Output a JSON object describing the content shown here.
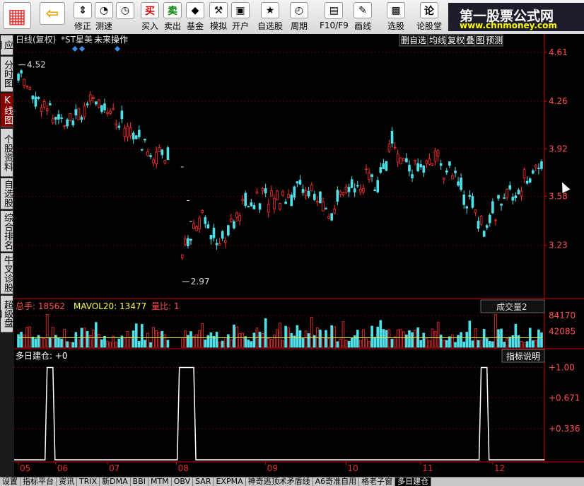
{
  "toolbar": {
    "buttons": [
      {
        "label": "",
        "name": "logo-button",
        "icon": "logo-icon",
        "x": 4
      },
      {
        "label": "",
        "name": "back-button",
        "icon": "back-arrow-icon",
        "x": 56
      },
      {
        "label": "修正",
        "name": "adjust-button",
        "icon": "arrows-icon",
        "x": 104
      },
      {
        "label": "测速",
        "name": "speed-test-button",
        "icon": "speed-icon",
        "x": 134
      },
      {
        "label": "",
        "name": "clock-button",
        "icon": "clock-icon",
        "x": 164
      },
      {
        "label": "买入",
        "name": "buy-button",
        "icon": "buy-icon",
        "x": 199
      },
      {
        "label": "卖出",
        "name": "sell-button",
        "icon": "sell-icon",
        "x": 231
      },
      {
        "label": "基金",
        "name": "fund-button",
        "icon": "fund-icon",
        "x": 263
      },
      {
        "label": "模拟",
        "name": "simulate-button",
        "icon": "hammer-icon",
        "x": 296
      },
      {
        "label": "开户",
        "name": "open-account-button",
        "icon": "lock-icon",
        "x": 327
      },
      {
        "label": "自选股",
        "name": "watchlist-button",
        "icon": "star-icon",
        "x": 364
      },
      {
        "label": "周期",
        "name": "period-button",
        "icon": "period-icon",
        "x": 410
      },
      {
        "label": "F10/F9",
        "name": "f10-button",
        "icon": "f10-icon",
        "x": 452
      },
      {
        "label": "画线",
        "name": "draw-line-button",
        "icon": "pen-icon",
        "x": 500
      },
      {
        "label": "选股",
        "name": "select-stock-button",
        "icon": "select-icon",
        "x": 547
      },
      {
        "label": "论股堂",
        "name": "forum-button",
        "icon": "forum-icon",
        "x": 589
      }
    ],
    "buy_icon": "买",
    "sell_icon": "卖",
    "forum_icon": "论"
  },
  "brand": {
    "title": "第一股票公式网",
    "url": "www.chnmoney.com"
  },
  "left_tabs": [
    {
      "label": "应用",
      "active": false
    },
    {
      "label": "分时图",
      "active": false
    },
    {
      "label": "K线图",
      "active": true
    },
    {
      "label": "个股资料",
      "active": false
    },
    {
      "label": "自选股",
      "active": false
    },
    {
      "label": "综合排名",
      "active": false
    },
    {
      "label": "牛叉诊股",
      "active": false
    },
    {
      "label": "超级盘口",
      "active": false
    }
  ],
  "chart_header": {
    "period": "日线(复权)",
    "stock": "*ST星美",
    "future_op": "未来操作",
    "buttons": [
      "删自选",
      "均线",
      "复权",
      "叠",
      "图",
      "预测"
    ]
  },
  "colors": {
    "up": "#ff3030",
    "down": "#4fe0e8",
    "grid": "#5a0000",
    "axis": "#d00000",
    "white": "#ffffff",
    "yellow": "#ffff40",
    "accent": "#ff5050"
  },
  "chart_data": [
    {
      "type": "candlestick",
      "title": "",
      "y_ticks": [
        4.61,
        4.26,
        3.92,
        3.58,
        3.23
      ],
      "ylim": [
        2.92,
        4.64
      ],
      "annotations": [
        {
          "label": "4.52",
          "value": 4.52,
          "index": 0
        },
        {
          "label": "2.97",
          "value": 2.97,
          "index": 57
        }
      ],
      "x_ticks": [
        {
          "label": "05",
          "index": 0
        },
        {
          "label": "06",
          "index": 13
        },
        {
          "label": "07",
          "index": 31
        },
        {
          "label": "08",
          "index": 55
        },
        {
          "label": "09",
          "index": 86
        },
        {
          "label": "10",
          "index": 114
        },
        {
          "label": "11",
          "index": 140
        },
        {
          "label": "12",
          "index": 165
        }
      ],
      "n_bars": 183
    },
    {
      "type": "bar",
      "title": "总手",
      "value_label": "总手: 18562",
      "ma_label": "MAVOL20: 13477",
      "ratio_label": "量比: 1",
      "selector": "成交量2",
      "y_ticks": [
        84170,
        42085
      ]
    },
    {
      "type": "line",
      "title": "多日建仓",
      "value_label": "多日建仓: +0",
      "button": "指标说明",
      "y_ticks": [
        "+1.00",
        "+0.671",
        "+0.336"
      ],
      "ylim": [
        0,
        1.05
      ],
      "pulses": [
        [
          10,
          12
        ],
        [
          56,
          61
        ],
        [
          161,
          163
        ]
      ]
    }
  ],
  "bottom_tabs": [
    "设置",
    "指标平台",
    "资讯",
    "TRIX",
    "新DMA",
    "BBI",
    "MTM",
    "OBV",
    "SAR",
    "EXPMA",
    "神奇逃顶术矛盾线",
    "A6奇准自用",
    "格老子窗",
    "多日建仓"
  ],
  "active_bottom_tab": "多日建仓"
}
